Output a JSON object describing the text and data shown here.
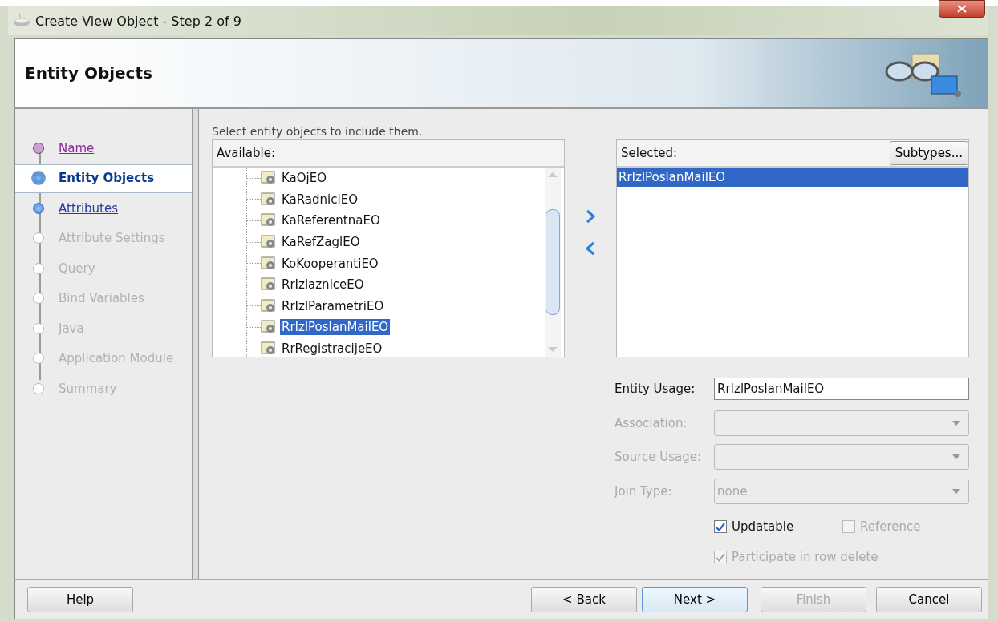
{
  "window": {
    "title": "Create View Object - Step 2 of 9"
  },
  "header": {
    "title": "Entity Objects"
  },
  "steps": [
    {
      "label": "Name",
      "selected": false,
      "kind": "visited"
    },
    {
      "label": "Entity Objects",
      "selected": true,
      "kind": "current"
    },
    {
      "label": "Attributes",
      "selected": false,
      "kind": "link"
    },
    {
      "label": "Attribute Settings",
      "selected": false,
      "kind": "disabled"
    },
    {
      "label": "Query",
      "selected": false,
      "kind": "disabled"
    },
    {
      "label": "Bind Variables",
      "selected": false,
      "kind": "disabled"
    },
    {
      "label": "Java",
      "selected": false,
      "kind": "disabled"
    },
    {
      "label": "Application Module",
      "selected": false,
      "kind": "disabled"
    },
    {
      "label": "Summary",
      "selected": false,
      "kind": "disabled"
    }
  ],
  "instruction": "Select entity objects to include them.",
  "available": {
    "heading": "Available:",
    "items": [
      {
        "label": "KaOjEO",
        "selected": false
      },
      {
        "label": "KaRadniciEO",
        "selected": false
      },
      {
        "label": "KaReferentnaEO",
        "selected": false
      },
      {
        "label": "KaRefZaglEO",
        "selected": false
      },
      {
        "label": "KoKooperantiEO",
        "selected": false
      },
      {
        "label": "RrIzlazniceEO",
        "selected": false
      },
      {
        "label": "RrIzlParametriEO",
        "selected": false
      },
      {
        "label": "RrIzlPoslanMailEO",
        "selected": true
      },
      {
        "label": "RrRegistracijeEO",
        "selected": false
      }
    ]
  },
  "selected_list": {
    "heading": "Selected:",
    "button": "Subtypes...",
    "items": [
      {
        "label": "RrIzlPoslanMailEO",
        "selected": true
      }
    ]
  },
  "fields": [
    {
      "label": "Entity Usage:",
      "kind": "text",
      "value": "RrIzlPoslanMailEO",
      "disabled": false
    },
    {
      "label": "Association:",
      "kind": "select",
      "disabled": true
    },
    {
      "label": "Source Usage:",
      "kind": "select",
      "disabled": true
    },
    {
      "label": "Join Type:",
      "kind": "select",
      "value": "none",
      "disabled": true
    }
  ],
  "checkboxes": [
    {
      "label": "Updatable",
      "checked": true,
      "disabled": false
    },
    {
      "label": "Reference",
      "checked": false,
      "disabled": true
    },
    {
      "label": "Participate in row delete",
      "checked": true,
      "disabled": true
    }
  ],
  "buttons": [
    {
      "label": "Help",
      "disabled": false,
      "default": false
    },
    {
      "label": "< Back",
      "disabled": false,
      "default": false
    },
    {
      "label": "Next >",
      "disabled": false,
      "default": true
    },
    {
      "label": "Finish",
      "disabled": true,
      "default": false
    },
    {
      "label": "Cancel",
      "disabled": false,
      "default": false
    }
  ]
}
